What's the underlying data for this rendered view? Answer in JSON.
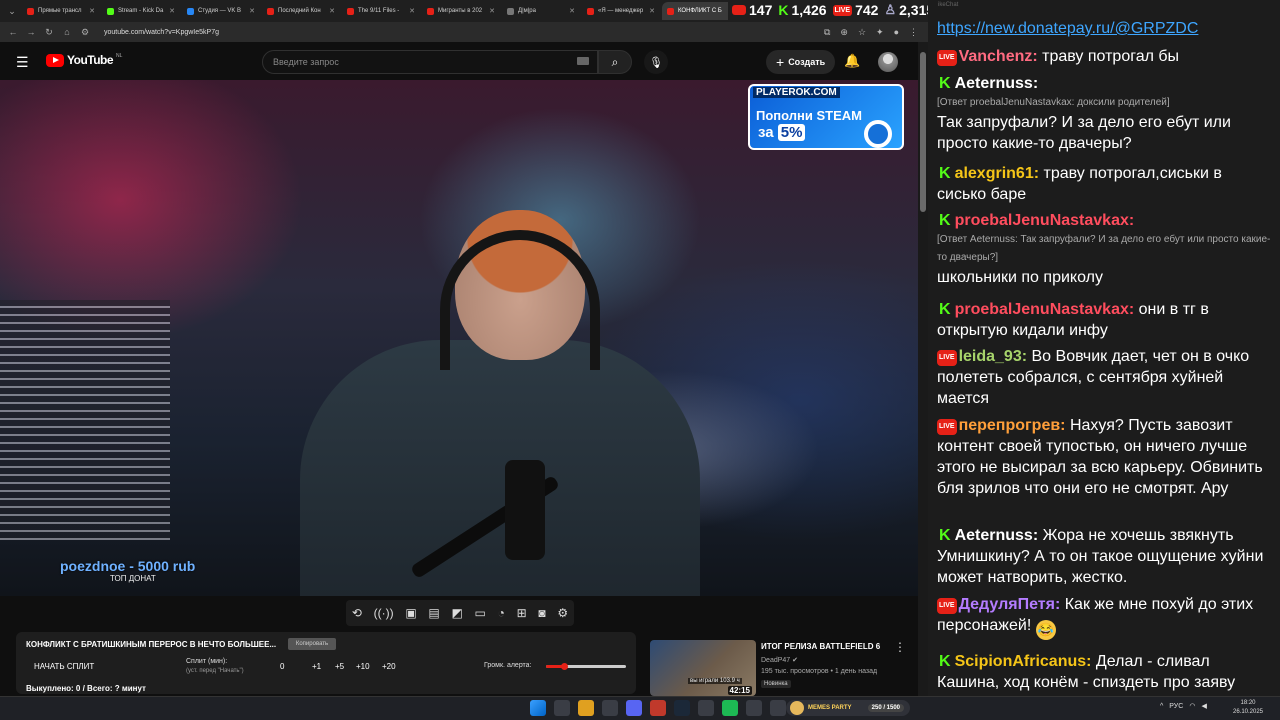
{
  "browser": {
    "tabs": [
      {
        "label": "Прямые трансл",
        "icon": "youtube-icon"
      },
      {
        "label": "Stream - Kick Da",
        "icon": "kick-icon"
      },
      {
        "label": "Студия — VK B",
        "icon": "vk-icon"
      },
      {
        "label": "Последний Кон",
        "icon": "youtube-icon"
      },
      {
        "label": "The 9/11 Files -",
        "icon": "youtube-icon"
      },
      {
        "label": "Мигранты в 202",
        "icon": "youtube-icon"
      },
      {
        "label": "Д|м|ра",
        "icon": "tab-icon"
      },
      {
        "label": "«Я — менеджер",
        "icon": "youtube-icon"
      },
      {
        "label": "КОНФЛИКТ С Б",
        "icon": "youtube-icon",
        "active": true
      }
    ],
    "url": "youtube.com/watch?v=KpgwIe5kP7g"
  },
  "stats": {
    "youtube": "147",
    "kick": "1,426",
    "vk": "742",
    "total": "2,315"
  },
  "youtube": {
    "logo": "YouTube",
    "logo_region": "NL",
    "search_placeholder": "Введите запрос",
    "create_label": "Создать"
  },
  "video": {
    "donation_name": "poezdnoe - 5000 rub",
    "donation_caption": "ТОП ДОНАТ",
    "promo_brand": "PLAYEROK.COM",
    "promo_line1": "Пополни STEAM",
    "promo_za": "за",
    "promo_pct": "5%"
  },
  "panel": {
    "title": "КОНФЛИКТ С БРАТИШКИНЫМ ПЕРЕРОС В НЕЧТО БОЛЬШЕЕ...",
    "copy_label": "Копировать",
    "start_split": "НАЧАТЬ СПЛИТ",
    "split_label": "Сплит (мин):",
    "split_hint": "(уст. перед \"Начать\")",
    "split_values": [
      "0",
      "+1",
      "+5",
      "+10",
      "+20"
    ],
    "alert_label": "Громк. алерта:",
    "alert_level": 0.22,
    "done": "Выкуплено: 0 / Всего: ? минут"
  },
  "recommended": {
    "title": "ИТОГ РЕЛИЗА BATTLEFIELD 6",
    "channel": "DeadP47",
    "meta": "195 тыс. просмотров • 1 день назад",
    "badge": "Новинка",
    "duration": "42:15",
    "played": "вы играли 103.9 ч"
  },
  "chat": {
    "header": "ikeChat",
    "link": "https://new.donatepay.ru/@GRPZDC",
    "messages": [
      {
        "platform": "vk",
        "name": "Vanchenz:",
        "color": "#ff6b81",
        "text": "траву потрогал бы"
      },
      {
        "platform": "kick",
        "name": "Aeternuss:",
        "color": "#ffffff",
        "reply": "[Ответ proebalJenuNastavkax: доксили родителей]",
        "text": "Так запруфали? И за дело его ебут или просто какие-то двачеры?"
      },
      {
        "platform": "kick",
        "name": "alexgrin61:",
        "color": "#f5c518",
        "text": "траву потрогал,сиськи в сиськo баре"
      },
      {
        "platform": "kick",
        "name": "proebalJenuNastavkax:",
        "color": "#ff4d5e",
        "reply": "[Ответ Aeternuss: Так запруфали? И за дело его ебут или просто какие-то двачеры?]",
        "text": "школьники по приколу"
      },
      {
        "platform": "kick",
        "name": "proebalJenuNastavkax:",
        "color": "#ff4d5e",
        "text": "они в тг в открытую кидали инфу"
      },
      {
        "platform": "vk",
        "name": "leida_93:",
        "color": "#a7d46b",
        "text": "Во Вовчик дает, чет он в очко полететь собрался, с сентября хуйней мается"
      },
      {
        "platform": "vk",
        "name": "перепрогрев:",
        "color": "#ff9f3a",
        "text": "Нахуя? Пусть завозит контент своей тупостью, он ничего лучше этого не высирал за всю карьеру. Обвинить бля зрилов что они его не смотрят. Ару"
      },
      {
        "platform": "kick",
        "name": "Aeternuss:",
        "color": "#ffffff",
        "text": "Жора не хочешь звякнуть Умнишкину? А то он такое ощущение хуйни может натворить, жестко."
      },
      {
        "platform": "vk",
        "name": "ДедуляПетя:",
        "color": "#b47cff",
        "text": "Как же мне похуй до этих персонажей!",
        "emoji": "😂"
      },
      {
        "platform": "kick",
        "name": "ScipionAfricanus:",
        "color": "#f5c518",
        "text": "Делал - сливал Кашина, ход конём - спиздеть про заяву"
      }
    ]
  },
  "taskbar": {
    "memes_label": "MEMES PARTY",
    "memes_count": "250 / 1500",
    "lang": "РУС",
    "time": "18:20",
    "date": "26.10.2025"
  }
}
